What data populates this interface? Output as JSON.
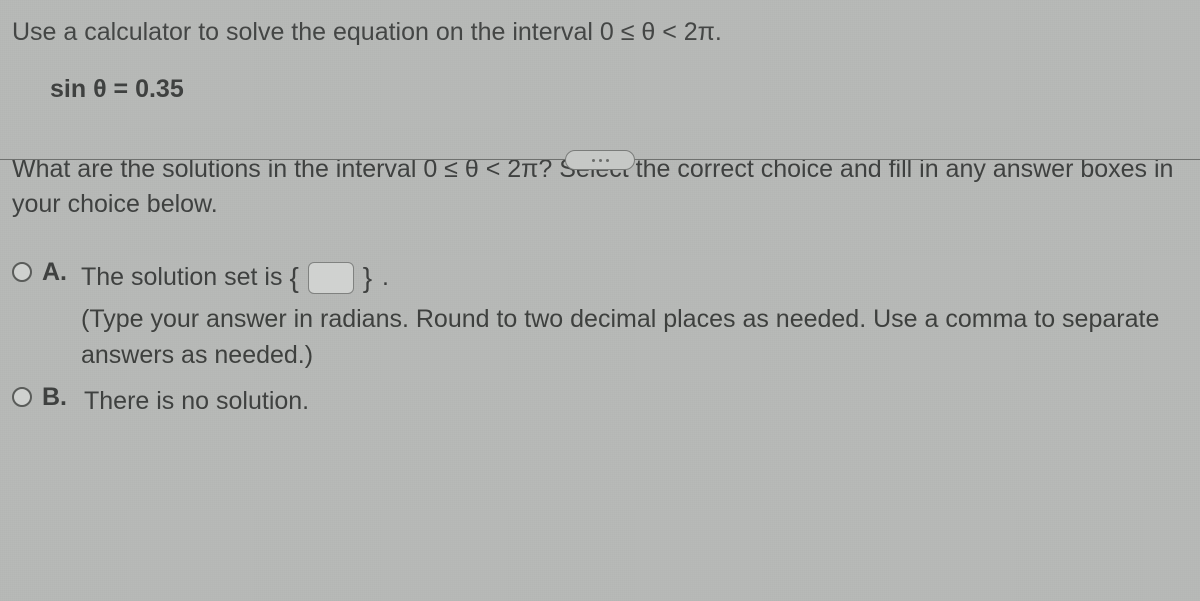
{
  "problem": {
    "instruction": "Use a calculator to solve the equation on the interval 0 ≤ θ < 2π.",
    "equation": "sin θ = 0.35"
  },
  "question": "What are the solutions in the interval 0 ≤ θ < 2π?  Select the correct choice and fill in any answer boxes in your choice below.",
  "choices": {
    "a": {
      "letter": "A.",
      "text": "The solution set is",
      "braceOpen": "{",
      "braceClose": "}",
      "periodMark": ".",
      "hint": "(Type your answer in radians.  Round to two decimal places as needed.  Use a comma to separate answers as needed.)"
    },
    "b": {
      "letter": "B.",
      "text": "There is no solution."
    }
  }
}
